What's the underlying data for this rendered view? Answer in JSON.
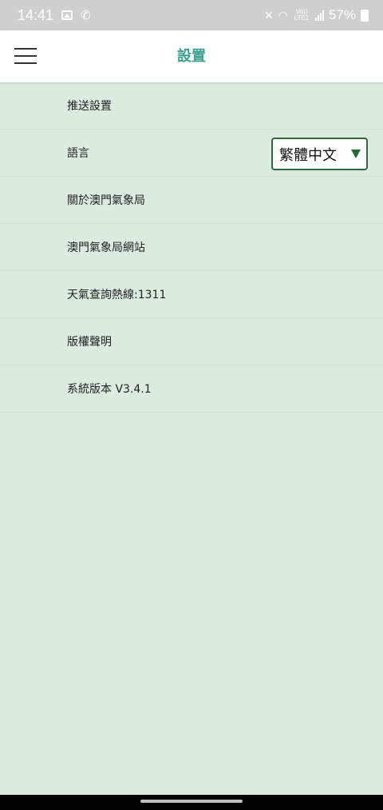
{
  "status_bar": {
    "time": "14:41",
    "lte_label": "Vo)) LTE1",
    "battery": "57%",
    "color": "#ffffff",
    "background": "#cfcfcf"
  },
  "header": {
    "title": "設置",
    "title_color": "#3aa08f",
    "menu_icon": "hamburger-menu-icon"
  },
  "settings": {
    "background": "#dcebe0",
    "items": [
      {
        "label": "推送設置"
      },
      {
        "label": "語言"
      },
      {
        "label": "關於澳門氣象局"
      },
      {
        "label": "澳門氣象局網站"
      },
      {
        "label": "天氣查詢熱線:1311"
      },
      {
        "label": "版權聲明"
      },
      {
        "label": "系統版本 V3.4.1"
      }
    ],
    "language_select": {
      "value": "繁體中文",
      "border_color": "#2e6b3a",
      "caret_icon": "dropdown-caret-icon"
    }
  }
}
